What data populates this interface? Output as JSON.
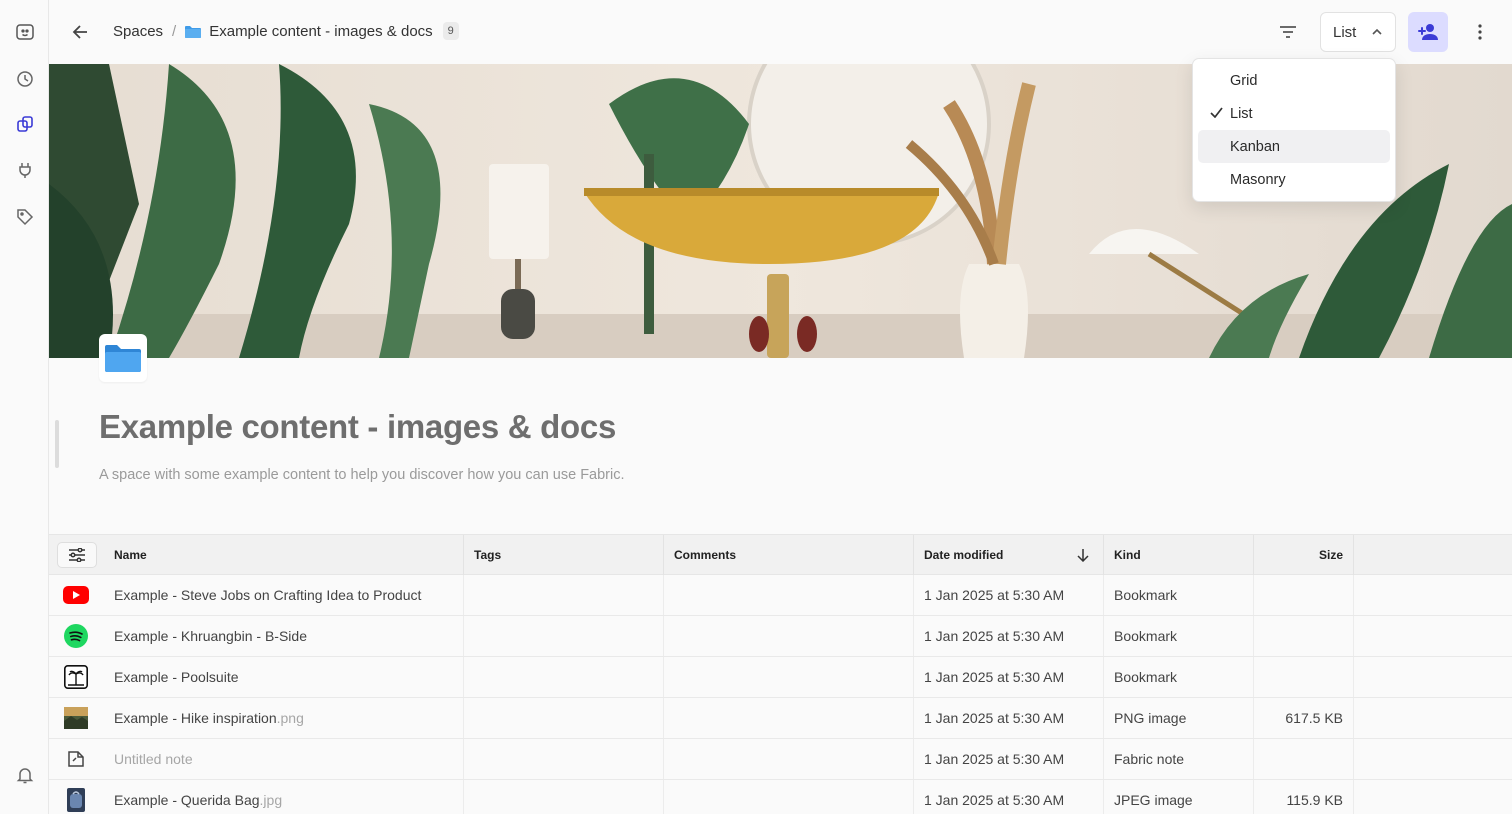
{
  "header": {
    "breadcrumb_root": "Spaces",
    "breadcrumb_sep": "/",
    "breadcrumb_current": "Example content - images & docs",
    "item_count": "9",
    "view_label": "List"
  },
  "view_menu": {
    "items": [
      {
        "label": "Grid",
        "checked": false
      },
      {
        "label": "List",
        "checked": true
      },
      {
        "label": "Kanban",
        "checked": false,
        "highlighted": true
      },
      {
        "label": "Masonry",
        "checked": false
      }
    ]
  },
  "space": {
    "title": "Example content - images & docs",
    "description": "A space with some example content to help you discover how you can use Fabric."
  },
  "table": {
    "columns": {
      "name": "Name",
      "tags": "Tags",
      "comments": "Comments",
      "date": "Date modified",
      "kind": "Kind",
      "size": "Size"
    },
    "rows": [
      {
        "icon": "youtube-icon",
        "name": "Example - Steve Jobs on Crafting Idea to Product",
        "ext": "",
        "date": "1 Jan 2025 at 5:30 AM",
        "kind": "Bookmark",
        "size": ""
      },
      {
        "icon": "spotify-icon",
        "name": "Example - Khruangbin - B-Side",
        "ext": "",
        "date": "1 Jan 2025 at 5:30 AM",
        "kind": "Bookmark",
        "size": ""
      },
      {
        "icon": "poolsuite-icon",
        "name": "Example - Poolsuite",
        "ext": "",
        "date": "1 Jan 2025 at 5:30 AM",
        "kind": "Bookmark",
        "size": ""
      },
      {
        "icon": "image-thumbnail",
        "name": "Example - Hike inspiration",
        "ext": ".png",
        "date": "1 Jan 2025 at 5:30 AM",
        "kind": "PNG image",
        "size": "617.5 KB"
      },
      {
        "icon": "note-icon",
        "name": "Untitled note",
        "ext": "",
        "date": "1 Jan 2025 at 5:30 AM",
        "kind": "Fabric note",
        "size": ""
      },
      {
        "icon": "image-thumbnail",
        "name": "Example - Querida Bag",
        "ext": ".jpg",
        "date": "1 Jan 2025 at 5:30 AM",
        "kind": "JPEG image",
        "size": "115.9 KB"
      }
    ]
  },
  "colors": {
    "accent": "#3b3bd6",
    "accent_bg": "#dcdcff",
    "youtube": "#ff0000",
    "spotify": "#1ed760",
    "folder": "#3f9be8"
  }
}
